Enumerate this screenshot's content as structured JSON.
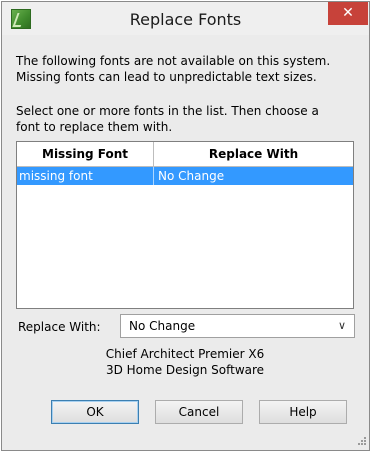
{
  "window": {
    "title": "Replace Fonts",
    "close_glyph": "✕"
  },
  "message": {
    "line1": "The following fonts are not available on this system.",
    "line2": "Missing fonts can lead to unpredictable text sizes.",
    "line3": "Select one or more fonts in the list.  Then choose a",
    "line4": "font to replace them with."
  },
  "table": {
    "headers": [
      "Missing Font",
      "Replace With"
    ],
    "rows": [
      {
        "missing": "missing font",
        "replace": "No Change",
        "selected": true
      }
    ]
  },
  "replace": {
    "label": "Replace With:",
    "value": "No Change",
    "arrow": "∨"
  },
  "info": {
    "line1": "Chief Architect Premier X6",
    "line2": "3D Home Design Software"
  },
  "buttons": {
    "ok": "OK",
    "cancel": "Cancel",
    "help": "Help"
  },
  "colors": {
    "selection": "#3399ff",
    "close": "#c7423a"
  }
}
